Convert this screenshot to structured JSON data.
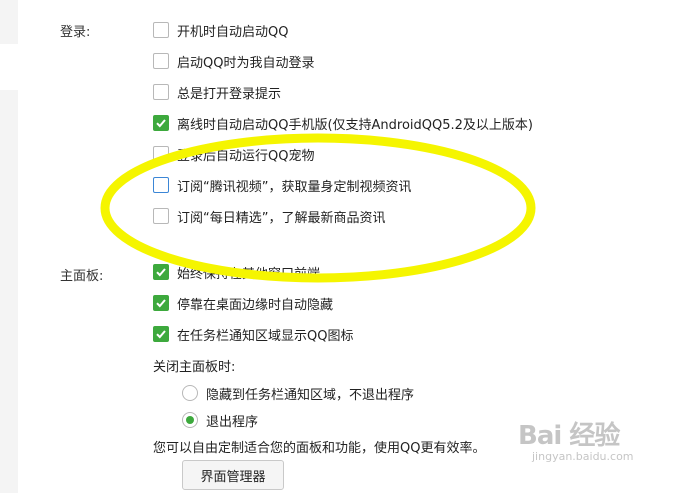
{
  "login": {
    "label": "登录:",
    "options": [
      {
        "text": "开机时自动启动QQ",
        "checked": false
      },
      {
        "text": "启动QQ时为我自动登录",
        "checked": false
      },
      {
        "text": "总是打开登录提示",
        "checked": false
      },
      {
        "text": "离线时自动启动QQ手机版(仅支持AndroidQQ5.2及以上版本)",
        "checked": true
      },
      {
        "text": "登录后自动运行QQ宠物",
        "checked": false
      },
      {
        "text": "订阅“腾讯视频”，获取量身定制视频资讯",
        "checked": false
      },
      {
        "text": "订阅“每日精选”，了解最新商品资讯",
        "checked": false
      }
    ]
  },
  "main_panel": {
    "label": "主面板:",
    "options": [
      {
        "text": "始终保持在其他窗口前端",
        "checked": true
      },
      {
        "text": "停靠在桌面边缘时自动隐藏",
        "checked": true
      },
      {
        "text": "在任务栏通知区域显示QQ图标",
        "checked": true
      }
    ],
    "close_heading": "关闭主面板时:",
    "close_options": [
      {
        "text": "隐藏到任务栏通知区域，不退出程序",
        "selected": false
      },
      {
        "text": "退出程序",
        "selected": true
      }
    ],
    "description": "您可以自由定制适合您的面板和功能，使用QQ更有效率。",
    "manager_button": "界面管理器"
  },
  "colors": {
    "check_green": "#3da93d",
    "highlight_yellow": "#f5f500"
  },
  "watermark": {
    "logo": "Bai 经验",
    "url": "jingyan.baidu.com"
  }
}
